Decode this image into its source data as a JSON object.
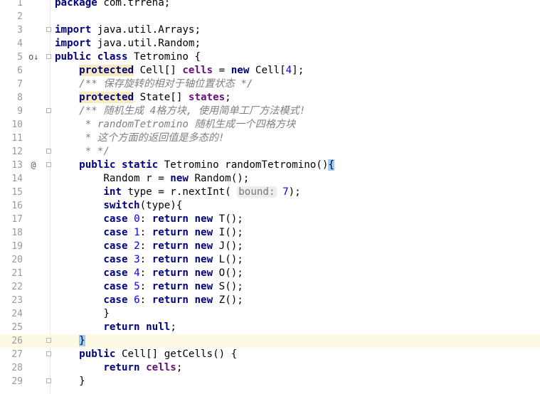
{
  "editor": {
    "lines": [
      {
        "num": "1",
        "tokens": [
          {
            "t": "package",
            "c": "kw"
          },
          {
            "t": " com.trrena;",
            "c": ""
          }
        ]
      },
      {
        "num": "2",
        "tokens": []
      },
      {
        "num": "3",
        "fold": true,
        "tokens": [
          {
            "t": "import",
            "c": "kw"
          },
          {
            "t": " java.util.Arrays;",
            "c": ""
          }
        ]
      },
      {
        "num": "4",
        "tokens": [
          {
            "t": "import",
            "c": "kw"
          },
          {
            "t": " java.util.Random;",
            "c": ""
          }
        ]
      },
      {
        "num": "5",
        "marker": "o↓",
        "fold": true,
        "tokens": [
          {
            "t": "public class",
            "c": "kw"
          },
          {
            "t": " Tetromino {",
            "c": ""
          }
        ]
      },
      {
        "num": "6",
        "tokens": [
          {
            "t": "    "
          },
          {
            "t": "protected",
            "c": "kwb"
          },
          {
            "t": " Cell[] "
          },
          {
            "t": "cells",
            "c": "fld"
          },
          {
            "t": " = "
          },
          {
            "t": "new",
            "c": "kw"
          },
          {
            "t": " Cell["
          },
          {
            "t": "4",
            "c": "num"
          },
          {
            "t": "];"
          }
        ]
      },
      {
        "num": "7",
        "tokens": [
          {
            "t": "    "
          },
          {
            "t": "/** 保存旋转的相对于轴位置状态 */",
            "c": "cmt"
          }
        ]
      },
      {
        "num": "8",
        "tokens": [
          {
            "t": "    "
          },
          {
            "t": "protected",
            "c": "kwb"
          },
          {
            "t": " State[] "
          },
          {
            "t": "states",
            "c": "fld"
          },
          {
            "t": ";"
          }
        ]
      },
      {
        "num": "9",
        "fold": true,
        "tokens": [
          {
            "t": "    "
          },
          {
            "t": "/** 随机生成 ",
            "c": "cmt"
          },
          {
            "t": "4",
            "c": "cmt"
          },
          {
            "t": "格方块, 使用简单工厂方法模式!",
            "c": "cmt"
          }
        ]
      },
      {
        "num": "10",
        "tokens": [
          {
            "t": "     "
          },
          {
            "t": "* ",
            "c": "cmt"
          },
          {
            "t": "randomTetromino",
            "c": "cmt"
          },
          {
            "t": " 随机生成一个四格方块",
            "c": "cmt"
          }
        ]
      },
      {
        "num": "11",
        "tokens": [
          {
            "t": "     "
          },
          {
            "t": "* 这个方面的返回值是多态的!",
            "c": "cmt"
          }
        ]
      },
      {
        "num": "12",
        "fold": true,
        "tokens": [
          {
            "t": "     "
          },
          {
            "t": "* */",
            "c": "cmt"
          }
        ]
      },
      {
        "num": "13",
        "marker": "@",
        "fold": true,
        "tokens": [
          {
            "t": "    "
          },
          {
            "t": "public static",
            "c": "kw"
          },
          {
            "t": " Tetromino randomTetromino()"
          },
          {
            "t": "{",
            "c": "brace"
          }
        ]
      },
      {
        "num": "14",
        "tokens": [
          {
            "t": "        Random r = "
          },
          {
            "t": "new",
            "c": "kw"
          },
          {
            "t": " Random();"
          }
        ]
      },
      {
        "num": "15",
        "tokens": [
          {
            "t": "        "
          },
          {
            "t": "int",
            "c": "kw"
          },
          {
            "t": " type = r.nextInt( "
          },
          {
            "t": "bound:",
            "c": "hint"
          },
          {
            "t": " "
          },
          {
            "t": "7",
            "c": "num"
          },
          {
            "t": ");"
          }
        ]
      },
      {
        "num": "16",
        "tokens": [
          {
            "t": "        "
          },
          {
            "t": "switch",
            "c": "kw"
          },
          {
            "t": "(type){"
          }
        ]
      },
      {
        "num": "17",
        "tokens": [
          {
            "t": "        "
          },
          {
            "t": "case",
            "c": "kw"
          },
          {
            "t": " "
          },
          {
            "t": "0",
            "c": "num"
          },
          {
            "t": ": "
          },
          {
            "t": "return new",
            "c": "kw"
          },
          {
            "t": " T();"
          }
        ]
      },
      {
        "num": "18",
        "tokens": [
          {
            "t": "        "
          },
          {
            "t": "case",
            "c": "kw"
          },
          {
            "t": " "
          },
          {
            "t": "1",
            "c": "num"
          },
          {
            "t": ": "
          },
          {
            "t": "return new",
            "c": "kw"
          },
          {
            "t": " I();"
          }
        ]
      },
      {
        "num": "19",
        "tokens": [
          {
            "t": "        "
          },
          {
            "t": "case",
            "c": "kw"
          },
          {
            "t": " "
          },
          {
            "t": "2",
            "c": "num"
          },
          {
            "t": ": "
          },
          {
            "t": "return new",
            "c": "kw"
          },
          {
            "t": " J();"
          }
        ]
      },
      {
        "num": "20",
        "tokens": [
          {
            "t": "        "
          },
          {
            "t": "case",
            "c": "kw"
          },
          {
            "t": " "
          },
          {
            "t": "3",
            "c": "num"
          },
          {
            "t": ": "
          },
          {
            "t": "return new",
            "c": "kw"
          },
          {
            "t": " L();"
          }
        ]
      },
      {
        "num": "21",
        "tokens": [
          {
            "t": "        "
          },
          {
            "t": "case",
            "c": "kw"
          },
          {
            "t": " "
          },
          {
            "t": "4",
            "c": "num"
          },
          {
            "t": ": "
          },
          {
            "t": "return new",
            "c": "kw"
          },
          {
            "t": " O();"
          }
        ]
      },
      {
        "num": "22",
        "tokens": [
          {
            "t": "        "
          },
          {
            "t": "case",
            "c": "kw"
          },
          {
            "t": " "
          },
          {
            "t": "5",
            "c": "num"
          },
          {
            "t": ": "
          },
          {
            "t": "return new",
            "c": "kw"
          },
          {
            "t": " S();"
          }
        ]
      },
      {
        "num": "23",
        "tokens": [
          {
            "t": "        "
          },
          {
            "t": "case",
            "c": "kw"
          },
          {
            "t": " "
          },
          {
            "t": "6",
            "c": "num"
          },
          {
            "t": ": "
          },
          {
            "t": "return new",
            "c": "kw"
          },
          {
            "t": " Z();"
          }
        ]
      },
      {
        "num": "24",
        "tokens": [
          {
            "t": "        }"
          }
        ]
      },
      {
        "num": "25",
        "tokens": [
          {
            "t": "        "
          },
          {
            "t": "return null",
            "c": "kw"
          },
          {
            "t": ";"
          }
        ]
      },
      {
        "num": "26",
        "fold": true,
        "highlight": true,
        "tokens": [
          {
            "t": "    "
          },
          {
            "t": "}",
            "c": "brace"
          }
        ]
      },
      {
        "num": "27",
        "fold": true,
        "tokens": [
          {
            "t": "    "
          },
          {
            "t": "public",
            "c": "kw"
          },
          {
            "t": " Cell[] getCells() {"
          }
        ]
      },
      {
        "num": "28",
        "tokens": [
          {
            "t": "        "
          },
          {
            "t": "return",
            "c": "kw"
          },
          {
            "t": " "
          },
          {
            "t": "cells",
            "c": "fld"
          },
          {
            "t": ";"
          }
        ]
      },
      {
        "num": "29",
        "fold": true,
        "tokens": [
          {
            "t": "    }"
          }
        ]
      }
    ]
  },
  "colors": {
    "keyword": "#000080",
    "field": "#660e7a",
    "number": "#0000ff",
    "comment": "#808080",
    "current_line": "#fcfae2",
    "brace_match": "#99ccff"
  }
}
